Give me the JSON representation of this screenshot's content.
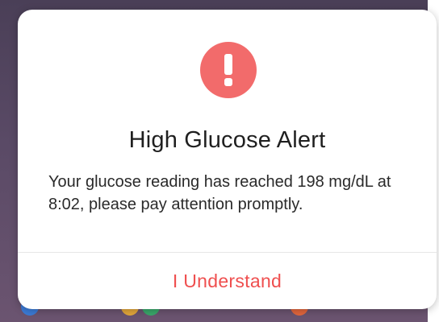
{
  "dialog": {
    "icon": "exclamation-icon",
    "title": "High Glucose Alert",
    "message": "Your glucose reading has reached 198 mg/dL at 8:02, please pay attention promptly.",
    "action_label": "I Understand"
  },
  "colors": {
    "alert_icon": "#f26b6b",
    "action_text": "#ef4f4f",
    "backdrop": "#4a3f57"
  }
}
